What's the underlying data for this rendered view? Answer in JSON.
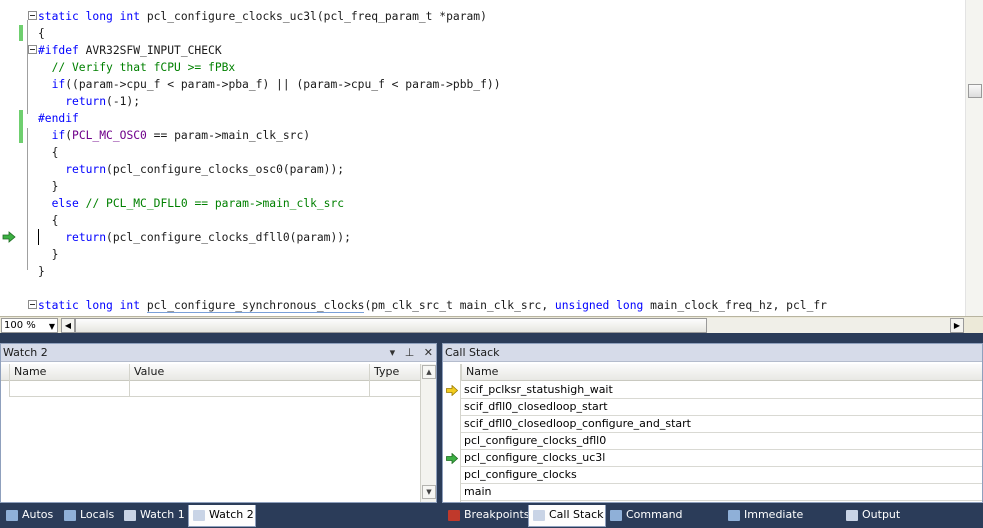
{
  "editor": {
    "zoom": "100 %",
    "lines": [
      [
        [
          "static long int ",
          "kw"
        ],
        [
          "pcl_configure_clocks_uc3l(pcl_freq_param_t *param)",
          ""
        ]
      ],
      [
        [
          "{",
          ""
        ]
      ],
      [
        [
          "#ifdef",
          "kw"
        ],
        [
          " AVR32SFW_INPUT_CHECK",
          ""
        ]
      ],
      [
        [
          "  // Verify that fCPU >= fPBx",
          "cm"
        ]
      ],
      [
        [
          "  ",
          ""
        ],
        [
          "if",
          "kw"
        ],
        [
          "((param->cpu_f < param->pba_f) || (param->cpu_f < param->pbb_f))",
          ""
        ]
      ],
      [
        [
          "    ",
          ""
        ],
        [
          "return",
          "kw"
        ],
        [
          "(-1);",
          ""
        ]
      ],
      [
        [
          "#endif",
          "kw"
        ]
      ],
      [
        [
          "  ",
          ""
        ],
        [
          "if",
          "kw"
        ],
        [
          "(",
          ""
        ],
        [
          "PCL_MC_OSC0",
          "mc"
        ],
        [
          " == param->main_clk_src)",
          ""
        ]
      ],
      [
        [
          "  {",
          ""
        ]
      ],
      [
        [
          "    ",
          ""
        ],
        [
          "return",
          "kw"
        ],
        [
          "(pcl_configure_clocks_osc0(param));",
          ""
        ]
      ],
      [
        [
          "  }",
          ""
        ]
      ],
      [
        [
          "  ",
          ""
        ],
        [
          "else",
          "kw"
        ],
        [
          " ",
          ""
        ],
        [
          "// PCL_MC_DFLL0 == param->main_clk_src",
          "cm"
        ]
      ],
      [
        [
          "  {",
          ""
        ]
      ],
      [
        [
          "    ",
          ""
        ],
        [
          "return",
          "kw"
        ],
        [
          "(pcl_configure_clocks_dfll0(param));",
          ""
        ]
      ],
      [
        [
          "  }",
          ""
        ]
      ],
      [
        [
          "}",
          ""
        ]
      ],
      [
        [
          "",
          ""
        ]
      ],
      [
        [
          "static long int ",
          "kw"
        ],
        [
          "pcl_configure_synchronous_clocks",
          "hl"
        ],
        [
          "(pm_clk_src_t main_clk_src, ",
          ""
        ],
        [
          "unsigned long",
          "kw"
        ],
        [
          " main_clock_freq_hz, pcl_fr",
          ""
        ]
      ]
    ]
  },
  "watch": {
    "title": "Watch 2",
    "columns": [
      "Name",
      "Value",
      "Type"
    ]
  },
  "callstack": {
    "title": "Call Stack",
    "column": "Name",
    "frames": [
      "scif_pclksr_statushigh_wait",
      "scif_dfll0_closedloop_start",
      "scif_dfll0_closedloop_configure_and_start",
      "pcl_configure_clocks_dfll0",
      "pcl_configure_clocks_uc3l",
      "pcl_configure_clocks",
      "main"
    ]
  },
  "tabs_left": [
    "Autos",
    "Locals",
    "Watch 1",
    "Watch 2"
  ],
  "tabs_right": [
    "Breakpoints",
    "Call Stack",
    "Command Window",
    "Immediate Window",
    "Output"
  ],
  "colors": {
    "keyword": "#0000ff",
    "comment": "#008000",
    "macro": "#6f008a",
    "chrome": "#2b3c59",
    "change_bar": "#6fcf6f",
    "current_arrow": "#f2cc1f",
    "caller_arrow": "#3cb043"
  },
  "icons": [
    "fold-icon",
    "instruction-pointer-icon",
    "pin-icon",
    "close-icon",
    "dropdown-icon",
    "scroll-up-icon",
    "scroll-down-icon"
  ]
}
